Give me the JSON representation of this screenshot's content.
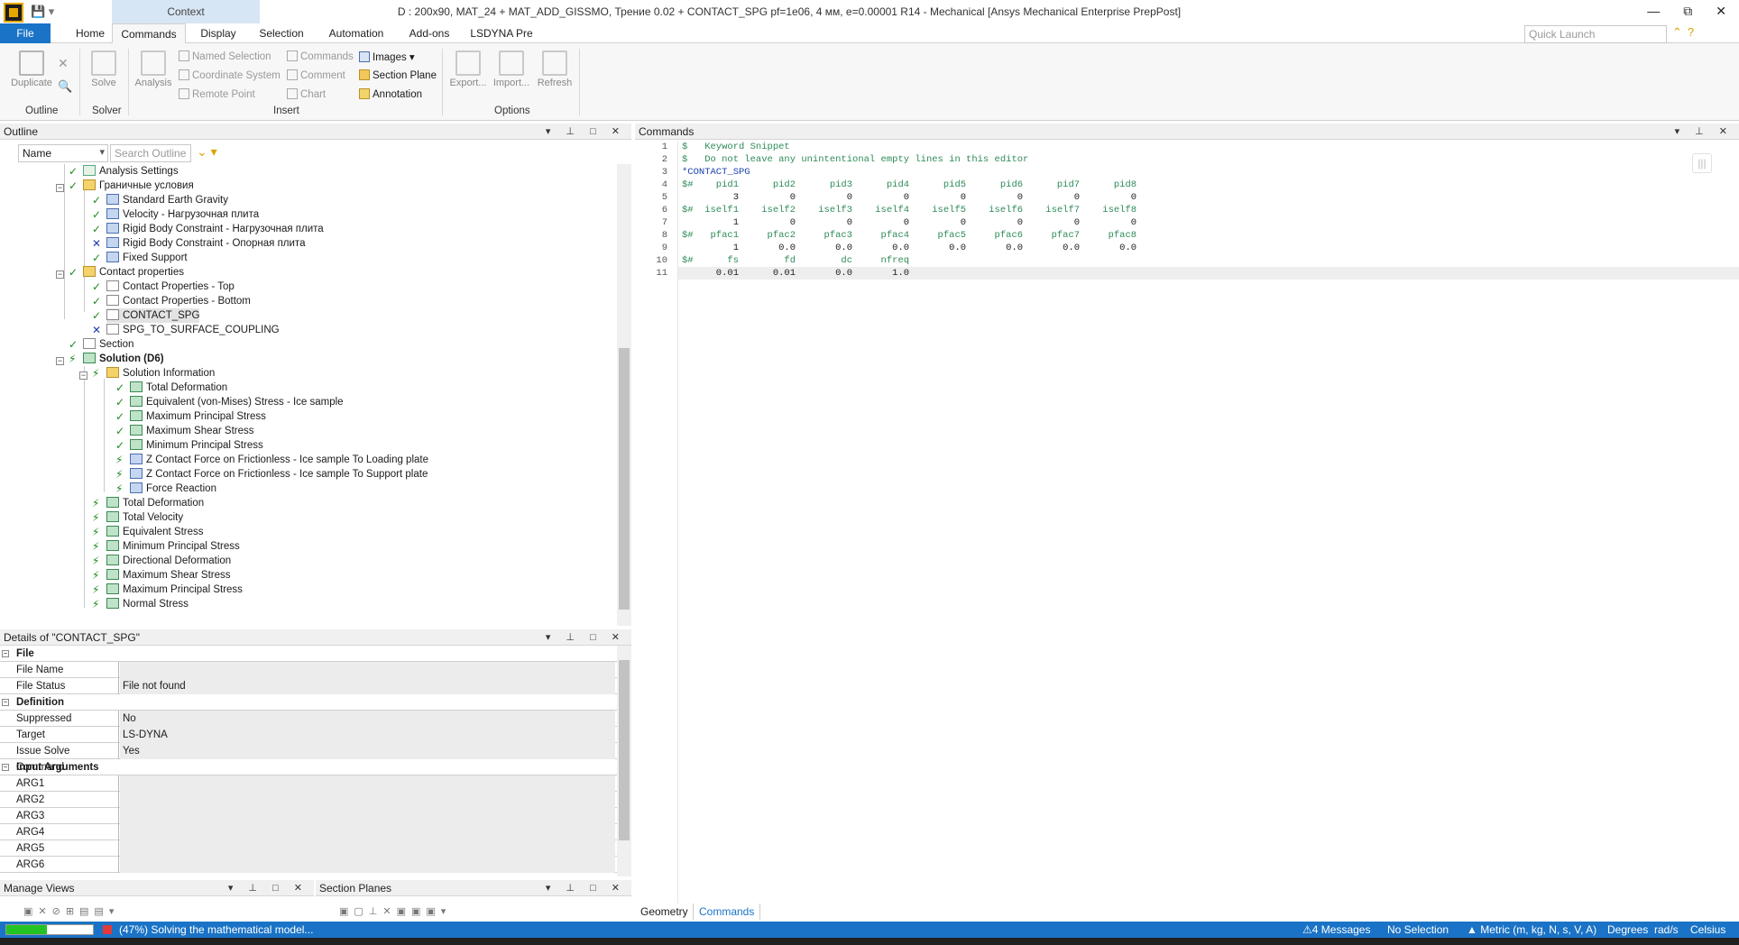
{
  "window": {
    "title": "D : 200x90, MAT_24 + MAT_ADD_GISSMO, Трение 0.02 + CONTACT_SPG pf=1e06, 4 мм, e=0.00001 R14 - Mechanical [Ansys Mechanical Enterprise PrepPost]",
    "context_tab": "Context",
    "controls": [
      "—",
      "⧉",
      "✕"
    ]
  },
  "ribbon_tabs": [
    "File",
    "Home",
    "Commands",
    "Display",
    "Selection",
    "Automation",
    "Add-ons",
    "LSDYNA Pre"
  ],
  "active_tab": "Commands",
  "quick_launch_placeholder": "Quick Launch",
  "ribbon": {
    "duplicate": "Duplicate",
    "solve": "Solve",
    "analysis": "Analysis",
    "named_selection": "Named Selection",
    "coordinate_system": "Coordinate System",
    "remote_point": "Remote Point",
    "commands": "Commands",
    "comment": "Comment",
    "chart": "Chart",
    "images": "Images",
    "section_plane": "Section Plane",
    "annotation": "Annotation",
    "export": "Export...",
    "import": "Import...",
    "refresh": "Refresh",
    "groups": {
      "outline": "Outline",
      "solver": "Solver",
      "insert": "Insert",
      "options": "Options"
    }
  },
  "outline": {
    "header": "Outline",
    "filter_select": "Name",
    "search_placeholder": "Search Outline",
    "tree": [
      "Analysis Settings",
      "Граничные условия",
      "Standard Earth Gravity",
      "Velocity - Нагрузочная плита",
      "Rigid Body Constraint - Нагрузочная плита",
      "Rigid Body Constraint - Опорная плита",
      "Fixed Support",
      "Contact properties",
      "Contact Properties - Top",
      "Contact Properties - Bottom",
      "CONTACT_SPG",
      "SPG_TO_SURFACE_COUPLING",
      "Section",
      "Solution (D6)",
      "Solution Information",
      "Total Deformation",
      "Equivalent (von-Mises) Stress - Ice sample",
      "Maximum Principal Stress",
      "Maximum Shear Stress",
      "Minimum Principal Stress",
      "Z Contact Force on Frictionless - Ice sample To Loading plate",
      "Z Contact Force on Frictionless - Ice sample To Support plate",
      "Force Reaction",
      "Total Deformation",
      "Total Velocity",
      "Equivalent Stress",
      "Minimum Principal Stress",
      "Directional Deformation",
      "Maximum Shear Stress",
      "Maximum Principal Stress",
      "Normal Stress"
    ]
  },
  "details": {
    "header": "Details of \"CONTACT_SPG\"",
    "rows": [
      {
        "section": "File"
      },
      {
        "k": "File Name",
        "v": ""
      },
      {
        "k": "File Status",
        "v": "File not found"
      },
      {
        "section": "Definition"
      },
      {
        "k": "Suppressed",
        "v": "No"
      },
      {
        "k": "Target",
        "v": "LS-DYNA"
      },
      {
        "k": "Issue Solve Command",
        "v": "Yes"
      },
      {
        "section": "Input Arguments"
      },
      {
        "k": "ARG1",
        "v": ""
      },
      {
        "k": "ARG2",
        "v": ""
      },
      {
        "k": "ARG3",
        "v": ""
      },
      {
        "k": "ARG4",
        "v": ""
      },
      {
        "k": "ARG5",
        "v": ""
      },
      {
        "k": "ARG6",
        "v": ""
      }
    ]
  },
  "manage_views": "Manage Views",
  "section_planes": "Section Planes",
  "commands_pane": {
    "header": "Commands",
    "lines": [
      "$   Keyword Snippet",
      "$   Do not leave any unintentional empty lines in this editor",
      "*CONTACT_SPG",
      "$#    pid1      pid2      pid3      pid4      pid5      pid6      pid7      pid8",
      "         3         0         0         0         0         0         0         0",
      "$#  iself1    iself2    iself3    iself4    iself5    iself6    iself7    iself8",
      "         1         0         0         0         0         0         0         0",
      "$#   pfac1     pfac2     pfac3     pfac4     pfac5     pfac6     pfac7     pfac8",
      "         1       0.0       0.0       0.0       0.0       0.0       0.0       0.0",
      "$#      fs        fd        dc     nfreq",
      "      0.01      0.01       0.0       1.0"
    ],
    "line_numbers": [
      "1",
      "2",
      "3",
      "4",
      "5",
      "6",
      "7",
      "8",
      "9",
      "10",
      "11"
    ]
  },
  "bottom_tabs": [
    "Geometry",
    "Commands"
  ],
  "status": {
    "progress": 0.47,
    "text": "(47%) Solving the mathematical model...",
    "messages": "4 Messages",
    "selection": "No Selection",
    "units": "Metric (m, kg, N, s, V, A)",
    "degrees": "Degrees",
    "rad": "rad/s",
    "temp": "Celsius"
  },
  "colors": {
    "accent": "#1a73c6",
    "progress": "#24c324"
  }
}
